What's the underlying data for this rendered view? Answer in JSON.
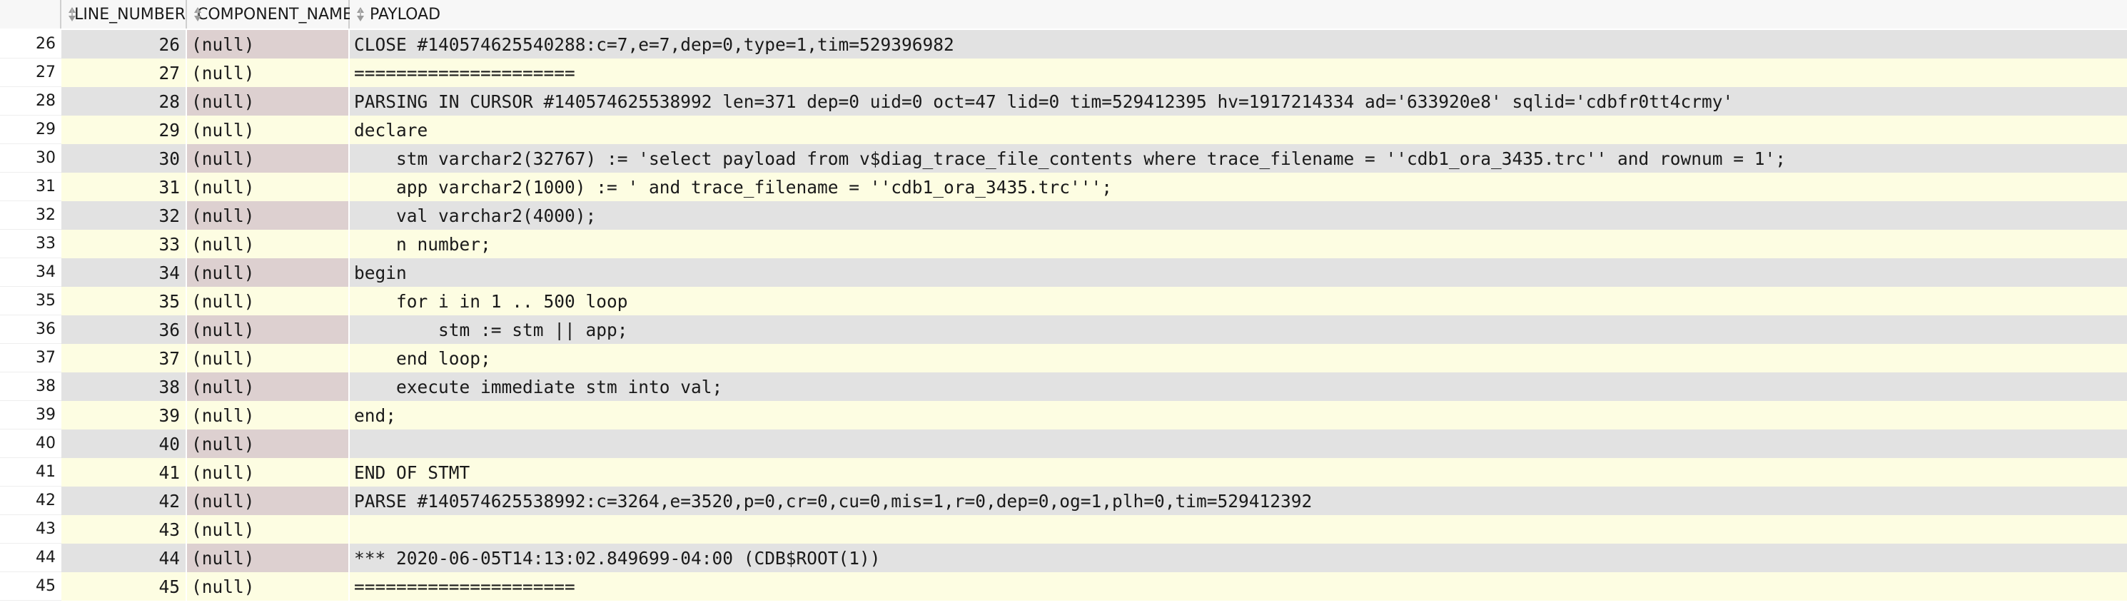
{
  "columns": {
    "line_number": "LINE_NUMBER",
    "component_name": "COMPONENT_NAME",
    "payload": "PAYLOAD"
  },
  "rows": [
    {
      "rownum": "26",
      "line_number": "26",
      "component_name": "(null)",
      "payload": "CLOSE #140574625540288:c=7,e=7,dep=0,type=1,tim=529396982"
    },
    {
      "rownum": "27",
      "line_number": "27",
      "component_name": "(null)",
      "payload": "====================="
    },
    {
      "rownum": "28",
      "line_number": "28",
      "component_name": "(null)",
      "payload": "PARSING IN CURSOR #140574625538992 len=371 dep=0 uid=0 oct=47 lid=0 tim=529412395 hv=1917214334 ad='633920e8' sqlid='cdbfr0tt4crmy'"
    },
    {
      "rownum": "29",
      "line_number": "29",
      "component_name": "(null)",
      "payload": "declare"
    },
    {
      "rownum": "30",
      "line_number": "30",
      "component_name": "(null)",
      "payload": "    stm varchar2(32767) := 'select payload from v$diag_trace_file_contents where trace_filename = ''cdb1_ora_3435.trc'' and rownum = 1';"
    },
    {
      "rownum": "31",
      "line_number": "31",
      "component_name": "(null)",
      "payload": "    app varchar2(1000) := ' and trace_filename = ''cdb1_ora_3435.trc''';"
    },
    {
      "rownum": "32",
      "line_number": "32",
      "component_name": "(null)",
      "payload": "    val varchar2(4000);"
    },
    {
      "rownum": "33",
      "line_number": "33",
      "component_name": "(null)",
      "payload": "    n number;"
    },
    {
      "rownum": "34",
      "line_number": "34",
      "component_name": "(null)",
      "payload": "begin"
    },
    {
      "rownum": "35",
      "line_number": "35",
      "component_name": "(null)",
      "payload": "    for i in 1 .. 500 loop"
    },
    {
      "rownum": "36",
      "line_number": "36",
      "component_name": "(null)",
      "payload": "        stm := stm || app;"
    },
    {
      "rownum": "37",
      "line_number": "37",
      "component_name": "(null)",
      "payload": "    end loop;"
    },
    {
      "rownum": "38",
      "line_number": "38",
      "component_name": "(null)",
      "payload": "    execute immediate stm into val;"
    },
    {
      "rownum": "39",
      "line_number": "39",
      "component_name": "(null)",
      "payload": "end;"
    },
    {
      "rownum": "40",
      "line_number": "40",
      "component_name": "(null)",
      "payload": ""
    },
    {
      "rownum": "41",
      "line_number": "41",
      "component_name": "(null)",
      "payload": "END OF STMT"
    },
    {
      "rownum": "42",
      "line_number": "42",
      "component_name": "(null)",
      "payload": "PARSE #140574625538992:c=3264,e=3520,p=0,cr=0,cu=0,mis=1,r=0,dep=0,og=1,plh=0,tim=529412392"
    },
    {
      "rownum": "43",
      "line_number": "43",
      "component_name": "(null)",
      "payload": ""
    },
    {
      "rownum": "44",
      "line_number": "44",
      "component_name": "(null)",
      "payload": "*** 2020-06-05T14:13:02.849699-04:00 (CDB$ROOT(1))"
    },
    {
      "rownum": "45",
      "line_number": "45",
      "component_name": "(null)",
      "payload": "====================="
    }
  ],
  "colors": {
    "row_even_bg": "#e2e2e2",
    "row_odd_bg": "#fdfde2",
    "component_even_bg": "#ddd0d0"
  },
  "icons": {
    "sort": "sort-icon"
  }
}
